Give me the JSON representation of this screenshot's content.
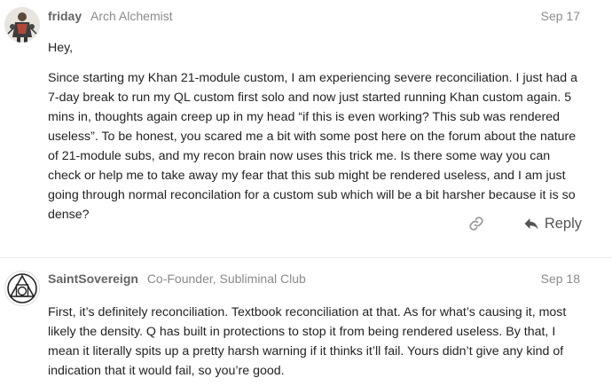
{
  "posts": [
    {
      "username": "friday",
      "user_title": "Arch Alchemist",
      "date": "Sep 17",
      "avatar_icon": "alchemist-avatar-icon",
      "paragraphs": [
        "Hey,",
        "Since starting my Khan 21-module custom, I am experiencing severe reconciliation. I just had a 7-day break to run my QL custom first solo and now just started running Khan custom again. 5 mins in, thoughts again creep up in my head “if this is even working? This sub was rendered useless”. To be honest, you scared me a bit with some post here on the forum about the nature of 21-module subs, and my recon brain now uses this trick me. Is there some way you can check or help me to take away my fear that this sub might be rendered useless, and I am just going through normal reconcilation for a custom sub which will be a bit harsher because it is so dense?"
      ],
      "actions": {
        "link_icon": "link-icon",
        "reply_icon": "reply-arrow-icon",
        "reply_label": "Reply"
      }
    },
    {
      "username": "SaintSovereign",
      "user_title": "Co-Founder, Subliminal Club",
      "date": "Sep 18",
      "avatar_icon": "alchemy-symbol-avatar-icon",
      "paragraphs": [
        "First, it’s definitely reconciliation. Textbook reconciliation at that. As for what’s causing it, most likely the density. Q has built in protections to stop it from being rendered useless. By that, I mean it literally spits up a pretty harsh warning if it thinks it’ll fail. Yours didn’t give any kind of indication that it would fail, so you’re good."
      ]
    }
  ],
  "colors": {
    "username": "#646464",
    "meta": "#8a8a8a",
    "body_text": "#222222",
    "icon": "#999999",
    "divider": "#e9e9e9"
  }
}
